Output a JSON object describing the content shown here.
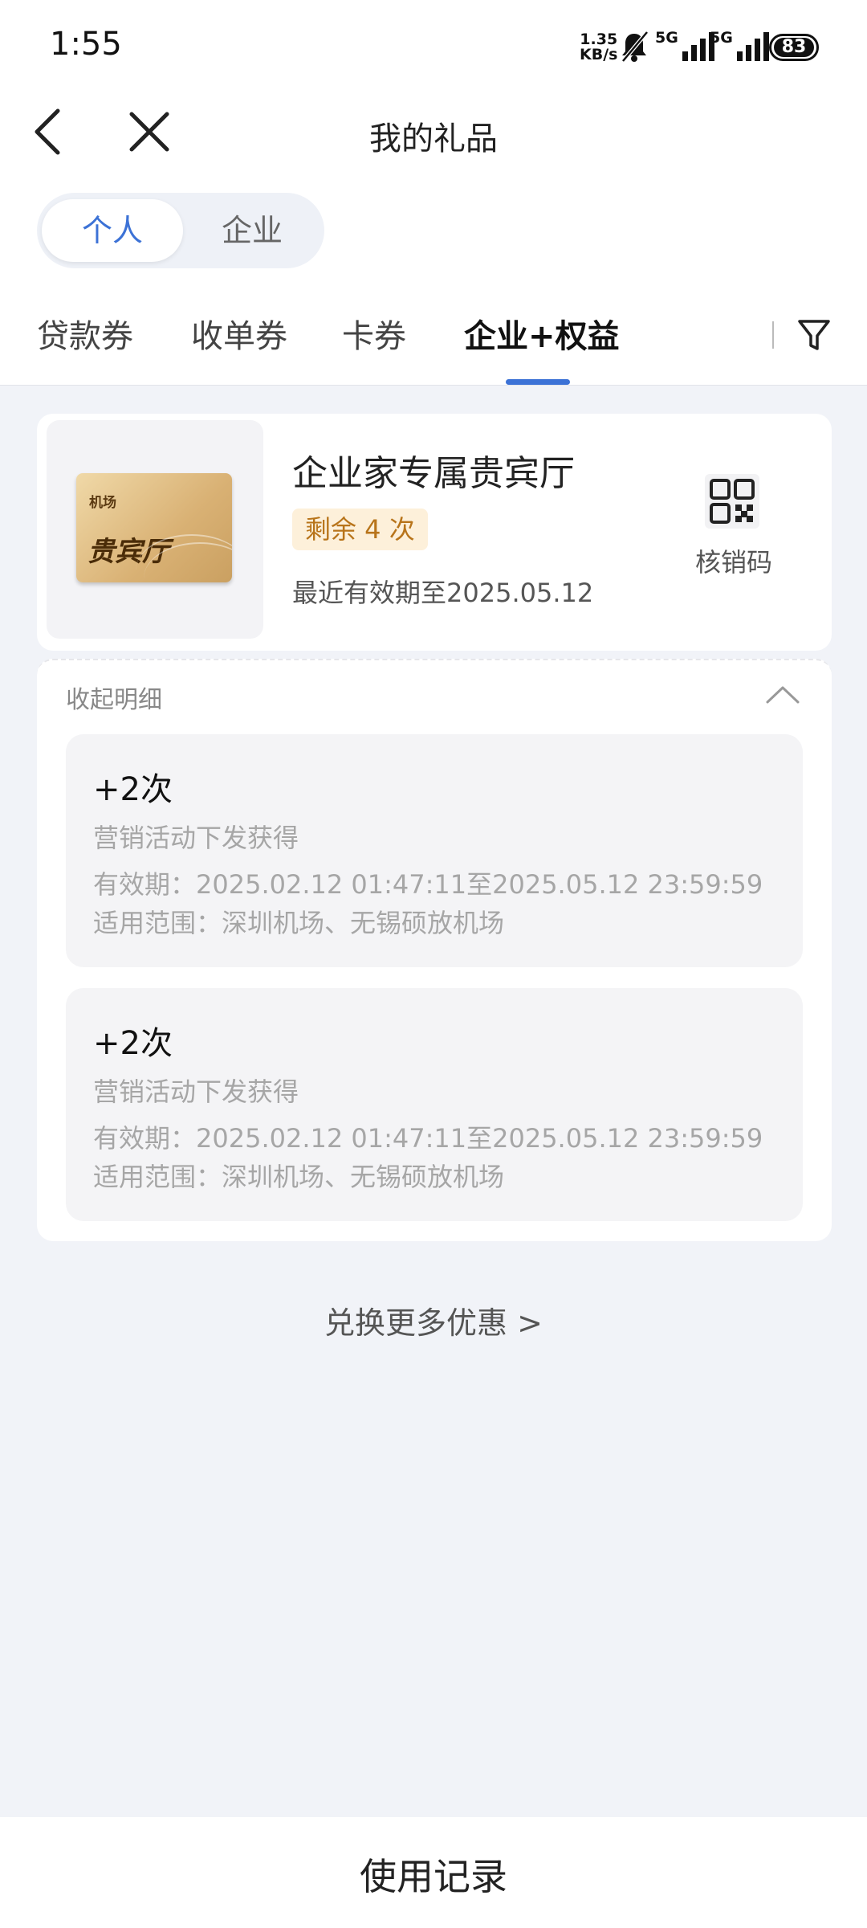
{
  "status_bar": {
    "time": "1:55",
    "net_speed_value": "1.35",
    "net_speed_unit": "KB/s",
    "signal1": "5G",
    "signal2": "5G",
    "battery": "83"
  },
  "header": {
    "title": "我的礼品",
    "back_icon": "chevron-left-icon",
    "close_icon": "close-icon"
  },
  "segment": {
    "items": [
      "个人",
      "企业"
    ],
    "selected": "个人"
  },
  "tabs": {
    "items": [
      "贷款券",
      "收单券",
      "卡券",
      "企业+权益"
    ],
    "active": "企业+权益",
    "filter_icon": "filter-icon"
  },
  "gift_card": {
    "thumbnail_small": "机场",
    "thumbnail_big": "贵宾厅",
    "name": "企业家专属贵宾厅",
    "badge": "剩余 4 次",
    "expiry": "最近有效期至2025.05.12",
    "qr_label": "核销码",
    "qr_icon": "qr-code-icon"
  },
  "details": {
    "header": "收起明细",
    "items": [
      {
        "amount": "+2次",
        "source": "营销活动下发获得",
        "period": "有效期：2025.02.12 01:47:11至2025.05.12 23:59:59",
        "scope_label": "适用范围：",
        "scope": "深圳机场、无锡硕放机场"
      },
      {
        "amount": "+2次",
        "source": "营销活动下发获得",
        "period": "有效期：2025.02.12 01:47:11至2025.05.12 23:59:59",
        "scope_label": "适用范围：",
        "scope": "深圳机场、无锡硕放机场"
      }
    ]
  },
  "more_link": "兑换更多优惠 >",
  "footer": {
    "label": "使用记录"
  },
  "colors": {
    "accent": "#3c72d6",
    "badge_bg": "#fdf0da",
    "badge_text": "#b8741a",
    "page_bg": "#f1f3f8"
  }
}
